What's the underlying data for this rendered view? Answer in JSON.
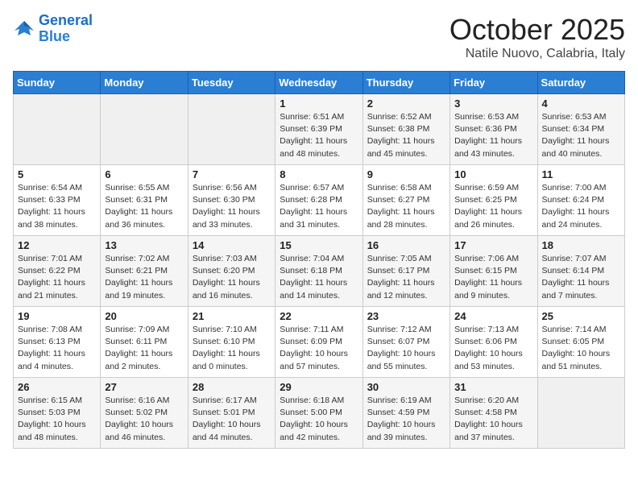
{
  "header": {
    "logo_line1": "General",
    "logo_line2": "Blue",
    "month": "October 2025",
    "location": "Natile Nuovo, Calabria, Italy"
  },
  "weekdays": [
    "Sunday",
    "Monday",
    "Tuesday",
    "Wednesday",
    "Thursday",
    "Friday",
    "Saturday"
  ],
  "weeks": [
    [
      {
        "day": "",
        "content": ""
      },
      {
        "day": "",
        "content": ""
      },
      {
        "day": "",
        "content": ""
      },
      {
        "day": "1",
        "content": "Sunrise: 6:51 AM\nSunset: 6:39 PM\nDaylight: 11 hours\nand 48 minutes."
      },
      {
        "day": "2",
        "content": "Sunrise: 6:52 AM\nSunset: 6:38 PM\nDaylight: 11 hours\nand 45 minutes."
      },
      {
        "day": "3",
        "content": "Sunrise: 6:53 AM\nSunset: 6:36 PM\nDaylight: 11 hours\nand 43 minutes."
      },
      {
        "day": "4",
        "content": "Sunrise: 6:53 AM\nSunset: 6:34 PM\nDaylight: 11 hours\nand 40 minutes."
      }
    ],
    [
      {
        "day": "5",
        "content": "Sunrise: 6:54 AM\nSunset: 6:33 PM\nDaylight: 11 hours\nand 38 minutes."
      },
      {
        "day": "6",
        "content": "Sunrise: 6:55 AM\nSunset: 6:31 PM\nDaylight: 11 hours\nand 36 minutes."
      },
      {
        "day": "7",
        "content": "Sunrise: 6:56 AM\nSunset: 6:30 PM\nDaylight: 11 hours\nand 33 minutes."
      },
      {
        "day": "8",
        "content": "Sunrise: 6:57 AM\nSunset: 6:28 PM\nDaylight: 11 hours\nand 31 minutes."
      },
      {
        "day": "9",
        "content": "Sunrise: 6:58 AM\nSunset: 6:27 PM\nDaylight: 11 hours\nand 28 minutes."
      },
      {
        "day": "10",
        "content": "Sunrise: 6:59 AM\nSunset: 6:25 PM\nDaylight: 11 hours\nand 26 minutes."
      },
      {
        "day": "11",
        "content": "Sunrise: 7:00 AM\nSunset: 6:24 PM\nDaylight: 11 hours\nand 24 minutes."
      }
    ],
    [
      {
        "day": "12",
        "content": "Sunrise: 7:01 AM\nSunset: 6:22 PM\nDaylight: 11 hours\nand 21 minutes."
      },
      {
        "day": "13",
        "content": "Sunrise: 7:02 AM\nSunset: 6:21 PM\nDaylight: 11 hours\nand 19 minutes."
      },
      {
        "day": "14",
        "content": "Sunrise: 7:03 AM\nSunset: 6:20 PM\nDaylight: 11 hours\nand 16 minutes."
      },
      {
        "day": "15",
        "content": "Sunrise: 7:04 AM\nSunset: 6:18 PM\nDaylight: 11 hours\nand 14 minutes."
      },
      {
        "day": "16",
        "content": "Sunrise: 7:05 AM\nSunset: 6:17 PM\nDaylight: 11 hours\nand 12 minutes."
      },
      {
        "day": "17",
        "content": "Sunrise: 7:06 AM\nSunset: 6:15 PM\nDaylight: 11 hours\nand 9 minutes."
      },
      {
        "day": "18",
        "content": "Sunrise: 7:07 AM\nSunset: 6:14 PM\nDaylight: 11 hours\nand 7 minutes."
      }
    ],
    [
      {
        "day": "19",
        "content": "Sunrise: 7:08 AM\nSunset: 6:13 PM\nDaylight: 11 hours\nand 4 minutes."
      },
      {
        "day": "20",
        "content": "Sunrise: 7:09 AM\nSunset: 6:11 PM\nDaylight: 11 hours\nand 2 minutes."
      },
      {
        "day": "21",
        "content": "Sunrise: 7:10 AM\nSunset: 6:10 PM\nDaylight: 11 hours\nand 0 minutes."
      },
      {
        "day": "22",
        "content": "Sunrise: 7:11 AM\nSunset: 6:09 PM\nDaylight: 10 hours\nand 57 minutes."
      },
      {
        "day": "23",
        "content": "Sunrise: 7:12 AM\nSunset: 6:07 PM\nDaylight: 10 hours\nand 55 minutes."
      },
      {
        "day": "24",
        "content": "Sunrise: 7:13 AM\nSunset: 6:06 PM\nDaylight: 10 hours\nand 53 minutes."
      },
      {
        "day": "25",
        "content": "Sunrise: 7:14 AM\nSunset: 6:05 PM\nDaylight: 10 hours\nand 51 minutes."
      }
    ],
    [
      {
        "day": "26",
        "content": "Sunrise: 6:15 AM\nSunset: 5:03 PM\nDaylight: 10 hours\nand 48 minutes."
      },
      {
        "day": "27",
        "content": "Sunrise: 6:16 AM\nSunset: 5:02 PM\nDaylight: 10 hours\nand 46 minutes."
      },
      {
        "day": "28",
        "content": "Sunrise: 6:17 AM\nSunset: 5:01 PM\nDaylight: 10 hours\nand 44 minutes."
      },
      {
        "day": "29",
        "content": "Sunrise: 6:18 AM\nSunset: 5:00 PM\nDaylight: 10 hours\nand 42 minutes."
      },
      {
        "day": "30",
        "content": "Sunrise: 6:19 AM\nSunset: 4:59 PM\nDaylight: 10 hours\nand 39 minutes."
      },
      {
        "day": "31",
        "content": "Sunrise: 6:20 AM\nSunset: 4:58 PM\nDaylight: 10 hours\nand 37 minutes."
      },
      {
        "day": "",
        "content": ""
      }
    ]
  ]
}
